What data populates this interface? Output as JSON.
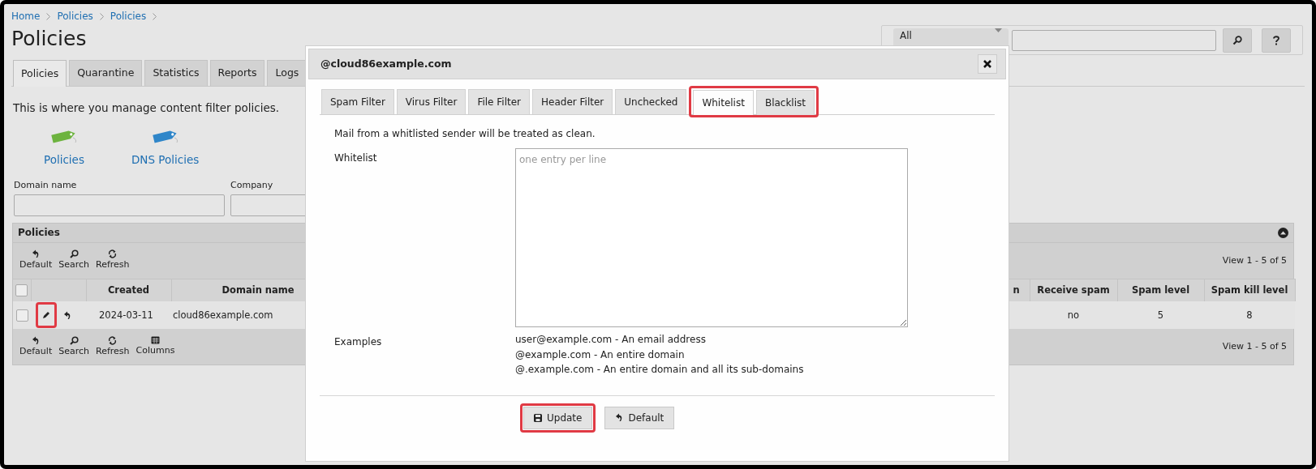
{
  "breadcrumb": [
    {
      "label": "Home"
    },
    {
      "label": "Policies"
    },
    {
      "label": "Policies"
    }
  ],
  "page_title": "Policies",
  "search": {
    "scope": "All"
  },
  "tabs": [
    {
      "label": "Policies",
      "selected": true
    },
    {
      "label": "Quarantine",
      "selected": false
    },
    {
      "label": "Statistics",
      "selected": false
    },
    {
      "label": "Reports",
      "selected": false
    },
    {
      "label": "Logs",
      "selected": false
    }
  ],
  "description": "This is where you manage content filter policies.",
  "shortcuts": [
    {
      "label": "Policies",
      "color": "#6db33f"
    },
    {
      "label": "DNS Policies",
      "color": "#2f86c9"
    }
  ],
  "filters": [
    {
      "label": "Domain name"
    },
    {
      "label": "Company"
    }
  ],
  "grid": {
    "title": "Policies",
    "expanded": true,
    "top_toolbar": [
      {
        "label": "Default",
        "kind": "undo"
      },
      {
        "label": "Search",
        "kind": "search"
      },
      {
        "label": "Refresh",
        "kind": "refresh"
      }
    ],
    "top_pager": "View 1 - 5 of 5",
    "all_checked": false,
    "columns": [
      {
        "label": "Created",
        "kind": "full"
      },
      {
        "label": "Domain name",
        "kind": "full"
      },
      {
        "label": "n",
        "kind": "partial"
      },
      {
        "label": "Receive spam",
        "kind": "full"
      },
      {
        "label": "Spam level",
        "kind": "full"
      },
      {
        "label": "Spam kill level",
        "kind": "full"
      }
    ],
    "rows": [
      {
        "checked": false,
        "edit_highlighted": true,
        "cells": [
          "2024-03-11",
          "cloud86example.com",
          "",
          "no",
          "5",
          "8"
        ]
      }
    ],
    "bottom_toolbar": [
      {
        "label": "Default",
        "kind": "undo"
      },
      {
        "label": "Search",
        "kind": "search"
      },
      {
        "label": "Refresh",
        "kind": "refresh"
      },
      {
        "label": "Columns",
        "kind": "columns"
      }
    ],
    "bottom_pager": "View 1 - 5 of 5"
  },
  "dialog": {
    "title": "@cloud86example.com",
    "tabs": [
      {
        "label": "Spam Filter",
        "selected": false,
        "highlighted": false
      },
      {
        "label": "Virus Filter",
        "selected": false,
        "highlighted": false
      },
      {
        "label": "File Filter",
        "selected": false,
        "highlighted": false
      },
      {
        "label": "Header Filter",
        "selected": false,
        "highlighted": false
      },
      {
        "label": "Unchecked",
        "selected": false,
        "highlighted": false
      },
      {
        "label": "Whitelist",
        "selected": true,
        "highlighted": true
      },
      {
        "label": "Blacklist",
        "selected": false,
        "highlighted": true
      }
    ],
    "note": "Mail from a whitlisted sender will be treated as clean.",
    "field": {
      "label": "Whitelist",
      "placeholder": "one entry per line"
    },
    "examples_label": "Examples",
    "examples": [
      "user@example.com - An email address",
      "@example.com - An entire domain",
      "@.example.com - An entire domain and all its sub-domains"
    ],
    "buttons": [
      {
        "label": "Update",
        "kind": "save",
        "highlighted": true
      },
      {
        "label": "Default",
        "kind": "undo",
        "highlighted": false
      }
    ]
  }
}
